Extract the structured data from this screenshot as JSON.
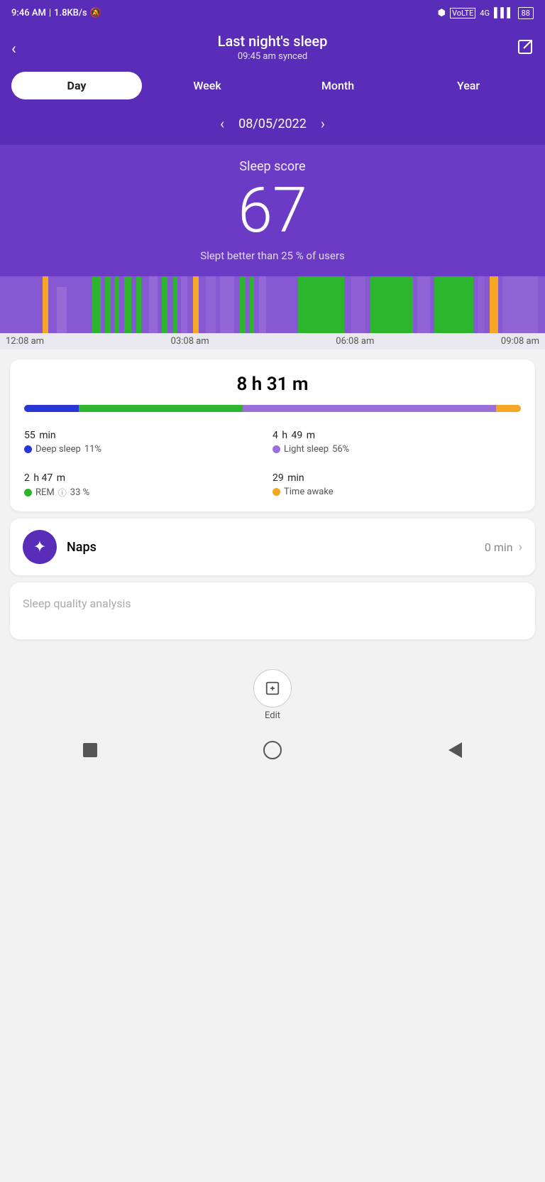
{
  "statusBar": {
    "time": "9:46 AM",
    "network": "1.8KB/s",
    "battery": "88"
  },
  "header": {
    "title": "Last night's sleep",
    "syncText": "09:45 am synced",
    "backLabel": "‹",
    "exportLabel": "⬡"
  },
  "tabs": {
    "items": [
      "Day",
      "Week",
      "Month",
      "Year"
    ],
    "activeIndex": 0
  },
  "dateNav": {
    "date": "08/05/2022",
    "prevLabel": "‹",
    "nextLabel": "›"
  },
  "sleepScore": {
    "label": "Sleep score",
    "value": "67",
    "subtext": "Slept better than 25 % of users"
  },
  "timeline": {
    "labels": [
      "12:08 am",
      "03:08 am",
      "06:08 am",
      "09:08 am"
    ]
  },
  "sleepStats": {
    "totalTime": "8 h 31 m",
    "deepSleep": {
      "value": "55",
      "unit": "min",
      "label": "Deep sleep",
      "pct": "11%"
    },
    "lightSleep": {
      "value": "4",
      "unitH": "h",
      "min": "49",
      "unitM": "m",
      "label": "Light sleep",
      "pct": "56%"
    },
    "rem": {
      "value": "2",
      "unitH": "h",
      "min": "47",
      "unitM": "m",
      "label": "REM",
      "pct": "33 %"
    },
    "awake": {
      "value": "29",
      "unit": "min",
      "label": "Time awake"
    }
  },
  "progressBar": {
    "segments": [
      {
        "color": "#2a36d4",
        "width": 11
      },
      {
        "color": "#2db52d",
        "width": 33
      },
      {
        "color": "#9b6fd8",
        "width": 51
      },
      {
        "color": "#f5a623",
        "width": 5
      }
    ]
  },
  "naps": {
    "label": "Naps",
    "value": "0 min",
    "iconChar": "✦"
  },
  "qualityAnalysis": {
    "label": "Sleep quality analysis"
  },
  "editBar": {
    "label": "Edit",
    "iconChar": "✎"
  },
  "bottomNav": {
    "squareLabel": "square",
    "circleLabel": "circle",
    "triangleLabel": "back"
  }
}
